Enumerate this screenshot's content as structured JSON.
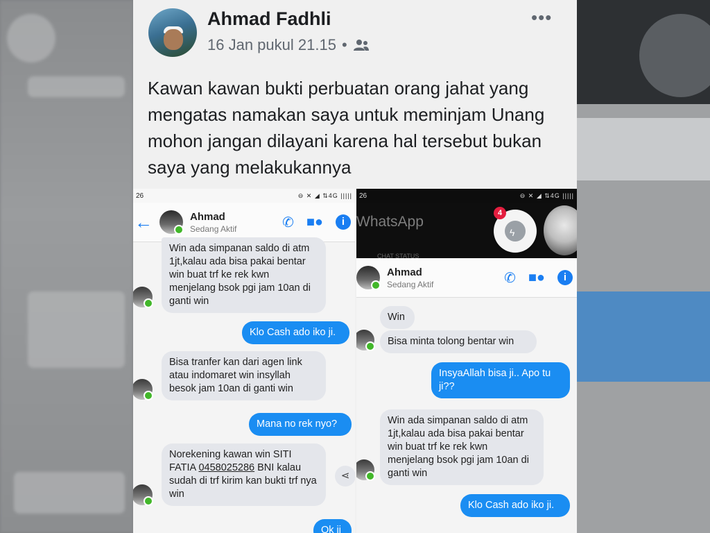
{
  "post": {
    "author": "Ahmad Fadhli",
    "date": "16 Jan pukul 21.15",
    "separator": "•",
    "audience_icon": "friends-icon",
    "more_label": "•••",
    "caption": "Kawan kawan bukti perbuatan orang jahat yang mengatas namakan saya untuk meminjam Unang mohon jangan dilayani karena hal tersebut bukan saya yang melakukannya"
  },
  "left_shot": {
    "status": {
      "time": "26",
      "icons": "⊖ ✕ ◢ ⇅4G ||||| "
    },
    "contact": {
      "name": "Ahmad",
      "status": "Sedang Aktif"
    },
    "messages": [
      {
        "dir": "in",
        "text": "Win ada simpanan saldo di atm 1jt,kalau ada bisa pakai bentar win buat trf ke rek kwn menjelang bsok pgi jam 10an di ganti win"
      },
      {
        "dir": "out",
        "text": "Klo Cash ado iko ji."
      },
      {
        "dir": "in",
        "text": "Bisa tranfer kan dari agen link atau indomaret win insyllah besok jam 10an di ganti win"
      },
      {
        "dir": "out",
        "text": "Mana no rek nyo?"
      },
      {
        "dir": "in",
        "text_before": "Norekening kawan win SITI FATIA ",
        "account": "0458025286",
        "text_after": " BNI kalau sudah di trf kirim kan bukti trf nya win"
      },
      {
        "dir": "out",
        "text": "Ok ji"
      }
    ]
  },
  "right_shot": {
    "status": {
      "time": "26",
      "icons": "⊖ ✕ ◢ ⇅4G |||||"
    },
    "background_app": {
      "title": "WhatsApp",
      "tabs": "CHAT      STATUS"
    },
    "bubble_badge": "4",
    "contact": {
      "name": "Ahmad",
      "status": "Sedang Aktif"
    },
    "messages": [
      {
        "dir": "in",
        "text": "Win"
      },
      {
        "dir": "in",
        "text": "Bisa minta tolong bentar win"
      },
      {
        "dir": "out",
        "text": "InsyaAllah bisa ji.. Apo tu ji??"
      },
      {
        "dir": "in",
        "text": "Win ada simpanan saldo di atm 1jt,kalau ada bisa pakai bentar win buat trf ke rek kwn menjelang bsok pgi jam 10an di ganti win"
      },
      {
        "dir": "out",
        "text": "Klo Cash ado iko ji."
      }
    ]
  },
  "colors": {
    "messenger_blue": "#1a8df2",
    "online_green": "#42b72a",
    "incoming_bubble": "#e4e6eb"
  }
}
